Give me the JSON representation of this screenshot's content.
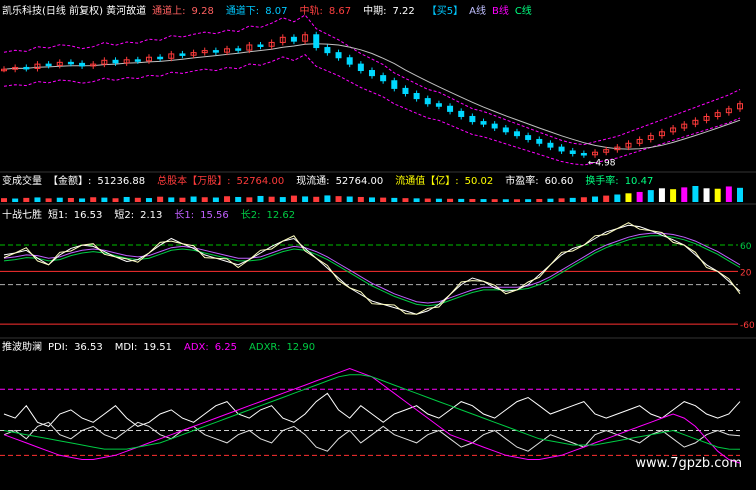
{
  "colors": {
    "bg": "#000000",
    "up": "#ff3b3b",
    "down": "#00d8ff",
    "white": "#ffffff",
    "yellow": "#ffff00",
    "magenta": "#ff00ff",
    "green": "#00cc44",
    "violet": "#c060ff",
    "red_dash": "#ff3030",
    "green_dash": "#00c000",
    "grey_dash": "#b0b0b0"
  },
  "panel1": {
    "title": "凯乐科技(日线 前复权) 黄河故道",
    "upper_label": "通道上:",
    "upper_value": "9.28",
    "lower_label": "通道下:",
    "lower_value": "8.07",
    "mid_label": "中轨:",
    "mid_value": "8.67",
    "mid2_label": "中期:",
    "mid2_value": "7.22",
    "tag_label": "【买5】",
    "a_label": "A线",
    "b_label": "B线",
    "c_label": "C线",
    "low_marker": "←4.98"
  },
  "panel2": {
    "title": "变成交量",
    "amount_label": "【金额】:",
    "amount_value": "51236.88",
    "total_label": "总股本【万股】:",
    "total_value": "52764.00",
    "float_label": "现流通:",
    "float_value": "52764.00",
    "float_mkt_label": "流通值【亿】:",
    "float_mkt_value": "50.02",
    "pe_label": "市盈率:",
    "pe_value": "60.60",
    "turnover_label": "换手率:",
    "turnover_value": "10.47"
  },
  "panel3": {
    "title": "十战七胜",
    "s1_label": "短1:",
    "s1_value": "16.53",
    "s2_label": "短2:",
    "s2_value": "2.13",
    "l1_label": "长1:",
    "l1_value": "15.56",
    "l2_label": "长2:",
    "l2_value": "12.62",
    "level_60": "60",
    "level_20": "20",
    "level_n60": "-60"
  },
  "panel4": {
    "title": "推波助澜",
    "pdi_label": "PDI:",
    "pdi_value": "36.53",
    "mdi_label": "MDI:",
    "mdi_value": "19.51",
    "adx_label": "ADX:",
    "adx_value": "6.25",
    "adxr_label": "ADXR:",
    "adxr_value": "12.90"
  },
  "watermark": "www.7gpzb.com",
  "chart_data": {
    "type": "line",
    "candles": {
      "close": [
        8.35,
        8.42,
        8.38,
        8.55,
        8.5,
        8.62,
        8.58,
        8.48,
        8.55,
        8.7,
        8.6,
        8.72,
        8.68,
        8.82,
        8.78,
        8.95,
        8.9,
        9.0,
        9.08,
        9.02,
        9.15,
        9.1,
        9.3,
        9.25,
        9.4,
        9.6,
        9.45,
        9.7,
        9.2,
        9.0,
        8.8,
        8.55,
        8.3,
        8.1,
        7.9,
        7.6,
        7.4,
        7.2,
        7.0,
        6.9,
        6.7,
        6.5,
        6.3,
        6.2,
        6.05,
        5.9,
        5.75,
        5.6,
        5.45,
        5.3,
        5.15,
        5.05,
        5.0,
        5.1,
        5.2,
        5.3,
        5.45,
        5.6,
        5.75,
        5.9,
        6.05,
        6.2,
        6.35,
        6.5,
        6.65,
        6.8,
        7.0
      ],
      "low_mark": 4.98
    },
    "volume": [
      42,
      38,
      45,
      50,
      40,
      47,
      44,
      39,
      52,
      48,
      41,
      55,
      46,
      43,
      58,
      50,
      47,
      60,
      52,
      49,
      63,
      55,
      51,
      66,
      58,
      54,
      70,
      61,
      57,
      72,
      64,
      60,
      55,
      50,
      48,
      45,
      42,
      40,
      38,
      36,
      35,
      34,
      33,
      32,
      31,
      30,
      30,
      31,
      33,
      36,
      40,
      45,
      52,
      60,
      70,
      82,
      95,
      110,
      130,
      150,
      140,
      160,
      175,
      150,
      145,
      170,
      155
    ],
    "kdj": {
      "short1": [
        45,
        48,
        52,
        40,
        30,
        45,
        55,
        60,
        58,
        50,
        42,
        35,
        38,
        48,
        60,
        70,
        62,
        55,
        45,
        40,
        35,
        30,
        38,
        48,
        58,
        66,
        70,
        55,
        40,
        25,
        10,
        -5,
        -15,
        -25,
        -30,
        -35,
        -40,
        -45,
        -40,
        -30,
        -15,
        0,
        10,
        5,
        -5,
        -10,
        -8,
        0,
        15,
        30,
        45,
        55,
        60,
        70,
        80,
        85,
        90,
        88,
        82,
        75,
        68,
        60,
        45,
        30,
        20,
        5,
        -10
      ],
      "long1": [
        40,
        42,
        45,
        44,
        40,
        42,
        48,
        52,
        54,
        52,
        48,
        44,
        42,
        44,
        50,
        56,
        58,
        56,
        52,
        48,
        44,
        40,
        40,
        42,
        48,
        54,
        58,
        56,
        50,
        42,
        32,
        22,
        12,
        2,
        -6,
        -14,
        -20,
        -26,
        -28,
        -26,
        -20,
        -14,
        -8,
        -4,
        -4,
        -4,
        -4,
        -2,
        4,
        12,
        22,
        32,
        42,
        52,
        60,
        66,
        72,
        76,
        78,
        78,
        76,
        72,
        66,
        58,
        50,
        40,
        30
      ]
    },
    "dmi": {
      "pdi": [
        30,
        28,
        34,
        26,
        24,
        30,
        32,
        28,
        26,
        30,
        34,
        28,
        24,
        26,
        30,
        32,
        28,
        26,
        30,
        34,
        36,
        30,
        28,
        32,
        34,
        28,
        26,
        30,
        36,
        40,
        32,
        28,
        34,
        30,
        26,
        30,
        32,
        34,
        30,
        28,
        32,
        36,
        34,
        30,
        28,
        32,
        36,
        38,
        34,
        30,
        32,
        34,
        36,
        30,
        28,
        30,
        32,
        34,
        30,
        28,
        32,
        36,
        34,
        30,
        28,
        30,
        36
      ],
      "mdi": [
        20,
        22,
        18,
        24,
        26,
        20,
        18,
        22,
        24,
        20,
        18,
        22,
        26,
        24,
        20,
        18,
        22,
        24,
        20,
        18,
        16,
        20,
        22,
        18,
        16,
        22,
        24,
        20,
        14,
        12,
        18,
        22,
        16,
        20,
        24,
        20,
        18,
        16,
        20,
        22,
        18,
        14,
        16,
        20,
        22,
        18,
        14,
        12,
        16,
        20,
        18,
        16,
        14,
        20,
        22,
        20,
        18,
        16,
        20,
        22,
        18,
        14,
        16,
        20,
        22,
        20,
        19.5
      ],
      "adx": [
        20,
        18,
        16,
        14,
        12,
        10,
        9,
        8,
        8,
        9,
        10,
        12,
        14,
        16,
        18,
        20,
        22,
        24,
        26,
        28,
        30,
        32,
        34,
        36,
        38,
        40,
        42,
        44,
        46,
        48,
        50,
        52,
        50,
        48,
        44,
        40,
        36,
        32,
        28,
        24,
        20,
        18,
        16,
        14,
        12,
        10,
        9,
        8,
        8,
        9,
        10,
        12,
        14,
        16,
        18,
        20,
        22,
        24,
        26,
        28,
        30,
        28,
        24,
        18,
        12,
        8,
        6.25
      ],
      "adxr": [
        22,
        21,
        20,
        19,
        18,
        17,
        16,
        15,
        14,
        13,
        13,
        13,
        14,
        15,
        16,
        18,
        20,
        22,
        24,
        26,
        28,
        30,
        32,
        34,
        36,
        38,
        40,
        42,
        44,
        46,
        48,
        49,
        49,
        48,
        46,
        44,
        42,
        40,
        38,
        36,
        34,
        32,
        30,
        28,
        26,
        24,
        22,
        20,
        18,
        17,
        16,
        15,
        15,
        15,
        16,
        17,
        18,
        19,
        20,
        21,
        22,
        20,
        18,
        16,
        14,
        13,
        12.9
      ]
    }
  }
}
